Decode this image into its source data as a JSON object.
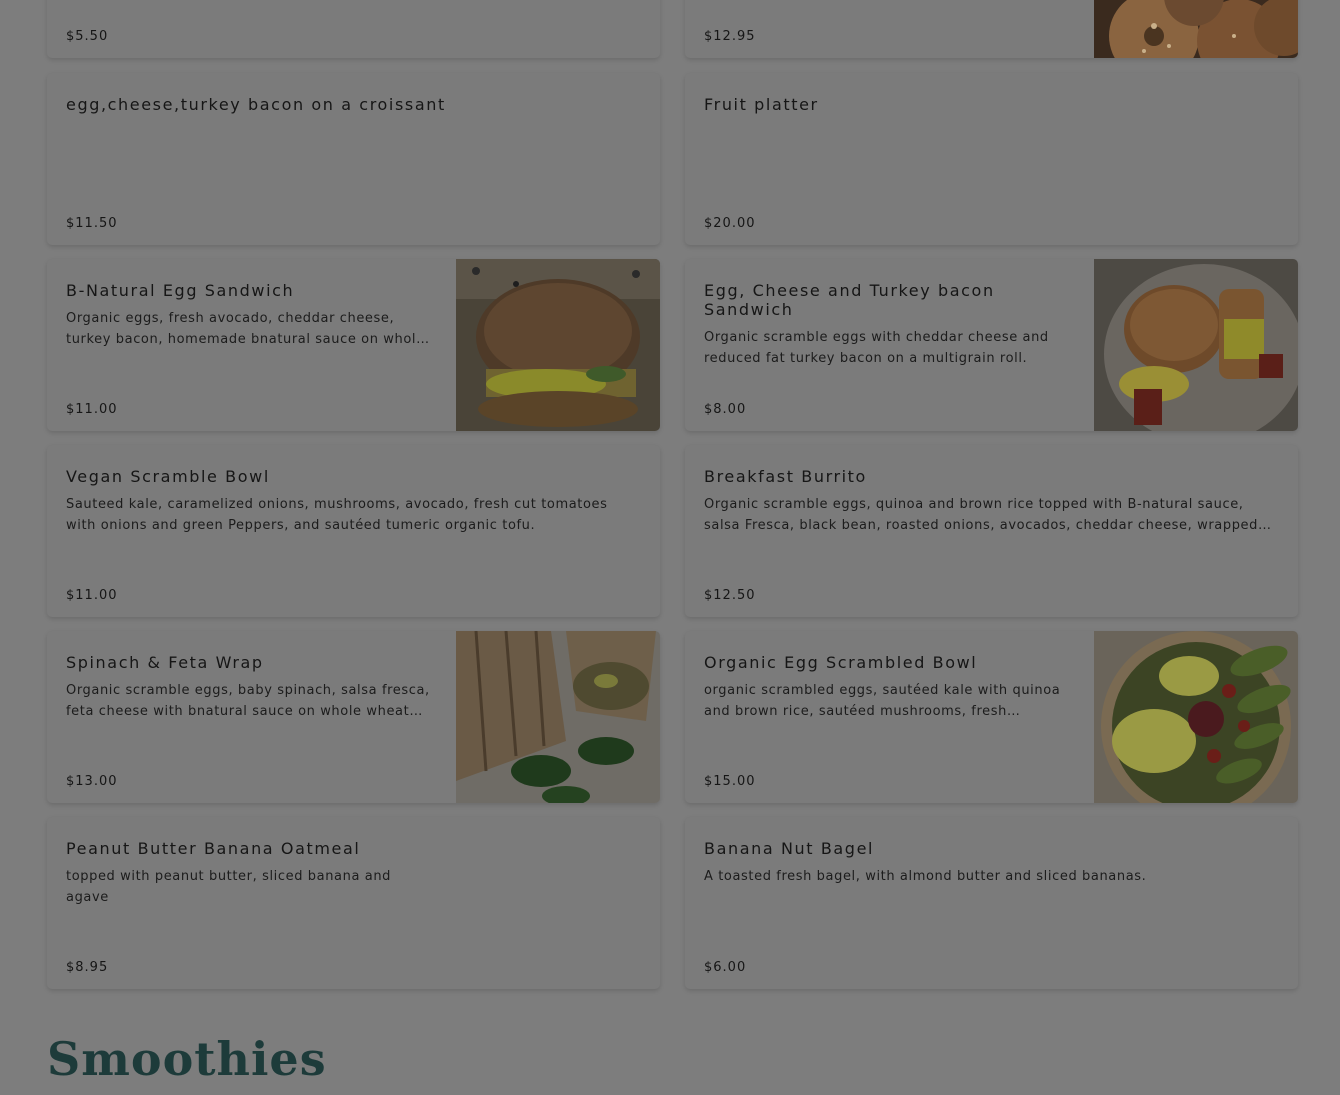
{
  "menu": {
    "items": [
      {
        "name": "",
        "description": "",
        "price": "$5.50",
        "image": ""
      },
      {
        "name": "",
        "description": "",
        "price": "$12.95",
        "image": "bagels-photo"
      },
      {
        "name": "egg,cheese,turkey bacon on a croissant",
        "description": "",
        "price": "$11.50",
        "image": ""
      },
      {
        "name": "Fruit platter",
        "description": "",
        "price": "$20.00",
        "image": ""
      },
      {
        "name": "B-Natural Egg Sandwich",
        "description": "Organic eggs, fresh avocado, cheddar cheese, turkey bacon, homemade bnatural sauce on whole wheat roll",
        "price": "$11.00",
        "image": "egg-sandwich-photo"
      },
      {
        "name": "Egg, Cheese and Turkey bacon Sandwich",
        "description": "Organic scramble eggs with cheddar cheese and reduced fat turkey bacon on a multigrain roll.",
        "price": "$8.00",
        "image": "turkey-bacon-sandwich-photo"
      },
      {
        "name": "Vegan Scramble Bowl",
        "description": "Sauteed kale, caramelized onions, mushrooms, avocado, fresh cut tomatoes with onions and green Peppers, and sautéed tumeric organic tofu.",
        "price": "$11.00",
        "image": ""
      },
      {
        "name": "Breakfast Burrito",
        "description": "Organic scramble eggs, quinoa and brown rice topped with B-natural sauce, salsa Fresca, black bean, roasted onions, avocados, cheddar cheese, wrapped in a whole wheat tortilla",
        "price": "$12.50",
        "image": ""
      },
      {
        "name": "Spinach & Feta Wrap",
        "description": "Organic scramble eggs, baby spinach, salsa fresca, feta cheese with bnatural sauce on whole wheat wrap",
        "price": "$13.00",
        "image": "wrap-photo"
      },
      {
        "name": "Organic Egg Scrambled Bowl",
        "description": "organic scrambled eggs, sautéed kale with quinoa and brown rice, sautéed mushrooms, fresh tomatoes, avocado, feta cheese",
        "price": "$15.00",
        "image": "egg-bowl-photo"
      },
      {
        "name": "Peanut Butter Banana Oatmeal",
        "description": "topped with peanut butter, sliced banana and agave",
        "price": "$8.95",
        "image": ""
      },
      {
        "name": "Banana Nut Bagel",
        "description": "A toasted fresh bagel, with almond butter and sliced bananas.",
        "price": "$6.00",
        "image": ""
      }
    ]
  },
  "section": {
    "title": "Smoothies"
  },
  "colors": {
    "page_bg": "#7d7d7d",
    "card_bg": "#7b7b7b",
    "heading": "#1d3b3a"
  }
}
